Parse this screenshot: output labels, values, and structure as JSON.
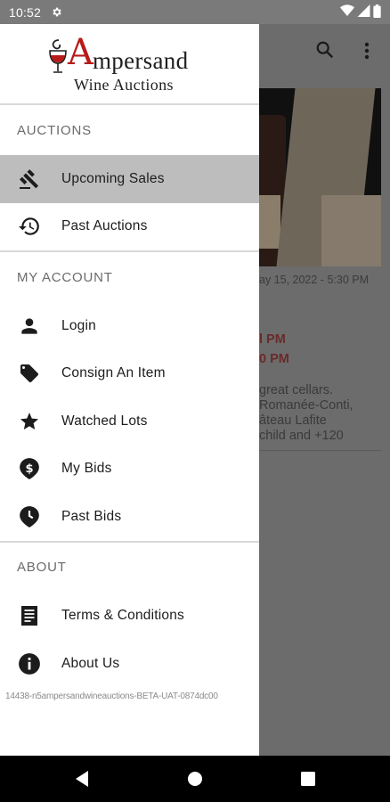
{
  "status_bar": {
    "time": "10:52",
    "icons": [
      "gear-icon",
      "wifi-icon",
      "signal-icon",
      "battery-icon"
    ]
  },
  "logo": {
    "ampersand_glyph": "A",
    "name": "mpersand",
    "subtitle": "Wine Auctions",
    "brand_color": "#b81a1a"
  },
  "drawer": {
    "sections": [
      {
        "header": "AUCTIONS",
        "items": [
          {
            "label": "Upcoming Sales",
            "icon": "gavel-icon",
            "active": true
          },
          {
            "label": "Past Auctions",
            "icon": "history-icon",
            "active": false
          }
        ]
      },
      {
        "header": "MY ACCOUNT",
        "items": [
          {
            "label": "Login",
            "icon": "person-icon"
          },
          {
            "label": "Consign An Item",
            "icon": "tag-icon"
          },
          {
            "label": "Watched Lots",
            "icon": "star-icon"
          },
          {
            "label": "My Bids",
            "icon": "dollar-pin-icon"
          },
          {
            "label": "Past Bids",
            "icon": "clock-pin-icon"
          }
        ]
      },
      {
        "header": "ABOUT",
        "items": [
          {
            "label": "Terms & Conditions",
            "icon": "document-icon"
          },
          {
            "label": "About Us",
            "icon": "info-icon"
          }
        ]
      }
    ],
    "build_info": "14438-n5ampersandwineauctions-BETA-UAT-0874dc00"
  },
  "background": {
    "date_text": "ay 15, 2022 - 5:30 PM",
    "time1": "l PM",
    "time2": "0 PM",
    "description": "great cellars.\nRomanée-Conti,\nâteau Lafite\nchild and +120",
    "accent_color": "#8b1a1a"
  },
  "nav_bar": {
    "buttons": [
      "back-icon",
      "home-icon",
      "recents-icon"
    ]
  }
}
